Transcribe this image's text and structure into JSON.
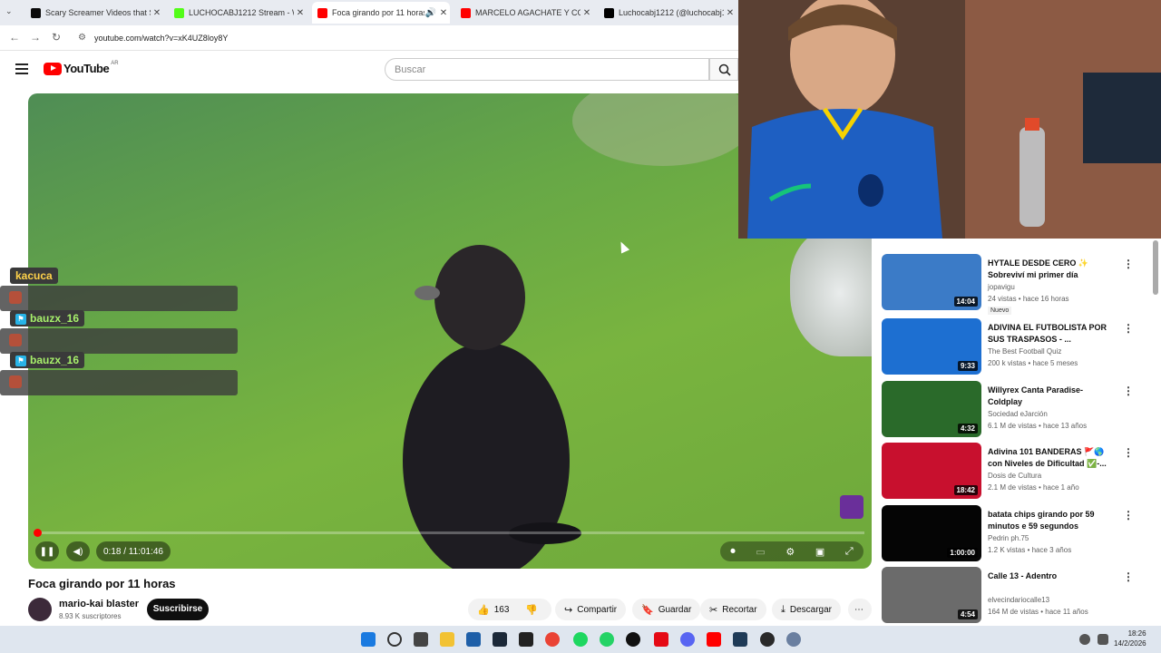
{
  "browser": {
    "tabs": [
      {
        "title": "Scary Screamer Videos that Sta",
        "color": "#0a0a0a",
        "active": false
      },
      {
        "title": "LUCHOCABJ1212 Stream - Wat",
        "color": "#53fc18",
        "active": false
      },
      {
        "title": "Foca girando por 11 horas",
        "color": "#ff0000",
        "active": true
      },
      {
        "title": "MARCELO AGACHATE Y CONO",
        "color": "#ff0000",
        "active": false
      },
      {
        "title": "Luchocabj1212 (@luchocabj19",
        "color": "#000000",
        "active": false
      }
    ],
    "url": "youtube.com/watch?v=xK4UZ8loy8Y"
  },
  "youtube": {
    "logo_text": "YouTube",
    "country": "AR",
    "search_placeholder": "Buscar"
  },
  "player": {
    "time": "0:18 / 11:01:46",
    "progress_fraction": 0.0005
  },
  "chat": [
    {
      "user": "kacuca",
      "badge": false
    },
    {
      "user": "bauzx_16",
      "badge": true
    },
    {
      "user": "bauzx_16",
      "badge": true
    }
  ],
  "video": {
    "title": "Foca girando por 11 horas",
    "channel": "mario-kai blaster",
    "subscribers": "8.93 K suscriptores",
    "subscribe_label": "Suscribirse",
    "likes": "163",
    "share_label": "Compartir",
    "save_label": "Guardar",
    "clip_label": "Recortar",
    "download_label": "Descargar"
  },
  "recommendations": [
    {
      "title": "HYTALE DESDE CERO ✨ Sobreviví mi primer día",
      "channel": "jopavigu",
      "meta": "24 vistas • hace 16 horas",
      "duration": "14:04",
      "badge": "Nuevo",
      "color": "#3b7bc7"
    },
    {
      "title": "ADIVINA EL FUTBOLISTA POR SUS TRASPASOS - ...",
      "channel": "The Best Football Quiz",
      "meta": "200 k vistas • hace 5 meses",
      "duration": "9:33",
      "badge": "",
      "color": "#1d6fd1"
    },
    {
      "title": "Willyrex Canta Paradise-Coldplay",
      "channel": "Sociedad eJarción",
      "meta": "6.1 M de vistas • hace 13 años",
      "duration": "4:32",
      "badge": "",
      "color": "#2a6a2a"
    },
    {
      "title": "Adivina 101 BANDERAS 🚩🌎 con Niveles de Dificultad ✅-...",
      "channel": "Dosis de Cultura",
      "meta": "2.1 M de vistas • hace 1 año",
      "duration": "18:42",
      "badge": "",
      "color": "#c8102e"
    },
    {
      "title": "batata chips girando por 59 minutos e 59 segundos",
      "channel": "Pedrin ph.75",
      "meta": "1.2 K vistas • hace 3 años",
      "duration": "1:00:00",
      "badge": "",
      "color": "#050505"
    },
    {
      "title": "Calle 13 - Adentro",
      "channel": "elvecindariocalle13",
      "meta": "164 M de vistas • hace 11 años",
      "duration": "4:54",
      "badge": "",
      "color": "#6b6b6b"
    }
  ],
  "clock": {
    "time": "18:26",
    "date": "14/2/2026"
  }
}
